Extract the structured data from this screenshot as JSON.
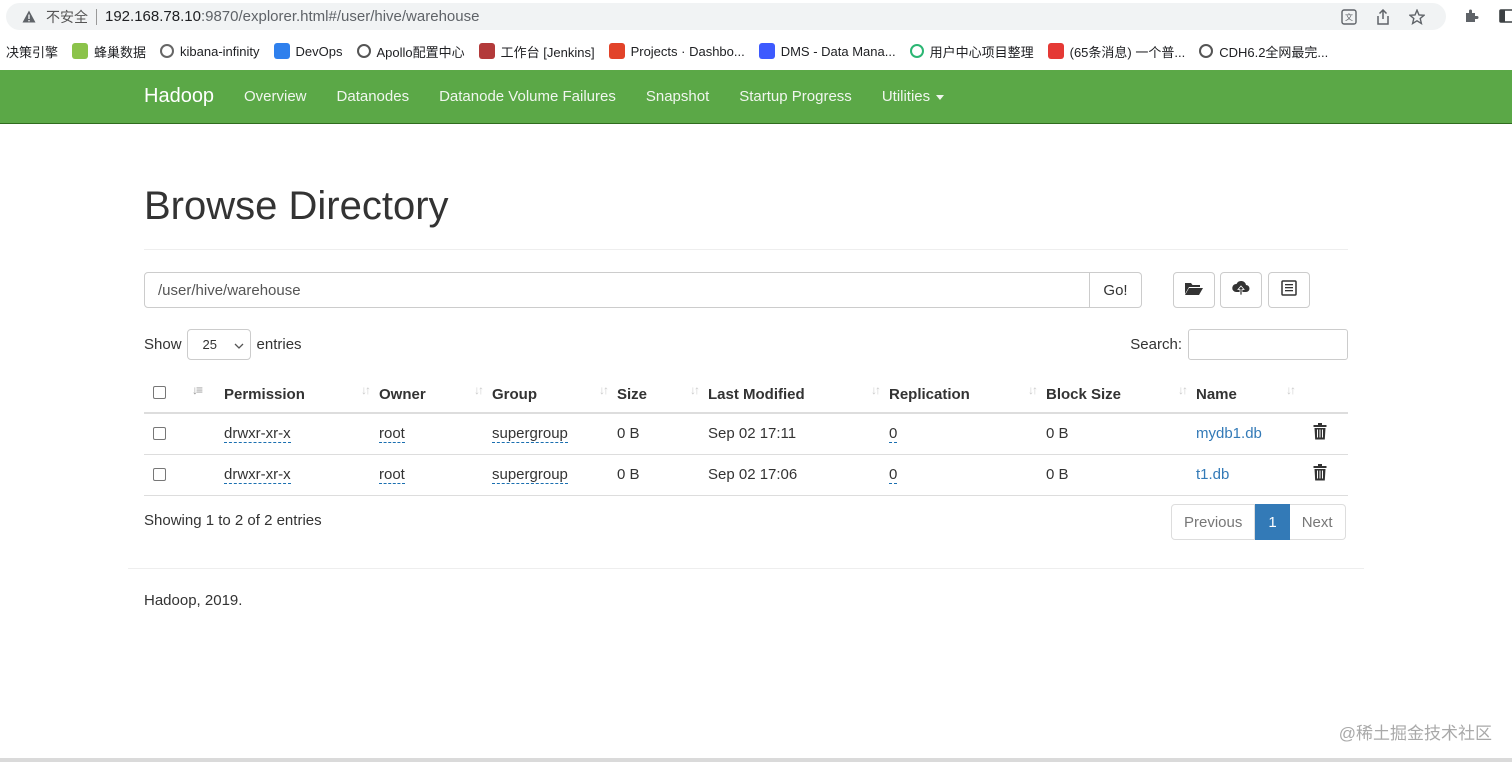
{
  "browser": {
    "security_label": "不安全",
    "url_host": "192.168.78.10",
    "url_path": ":9870/explorer.html#/user/hive/warehouse",
    "bookmarks": [
      {
        "label": "决策引擎",
        "icon": "none"
      },
      {
        "label": "蜂巢数据",
        "icon": "leaf-icon",
        "color": "#8bc34a"
      },
      {
        "label": "kibana-infinity",
        "icon": "kibana-icon",
        "color": "#666666"
      },
      {
        "label": "DevOps",
        "icon": "devops-icon",
        "color": "#2f80ed"
      },
      {
        "label": "Apollo配置中心",
        "icon": "apollo-icon",
        "color": "#555555"
      },
      {
        "label": "工作台 [Jenkins]",
        "icon": "jenkins-icon",
        "color": "#b33a3a"
      },
      {
        "label": "Projects · Dashbo...",
        "icon": "gitlab-icon",
        "color": "#e24329"
      },
      {
        "label": "DMS - Data Mana...",
        "icon": "dms-icon",
        "color": "#3d5afe"
      },
      {
        "label": "用户中心项目整理",
        "icon": "refresh-icon",
        "color": "#2bb673"
      },
      {
        "label": "(65条消息) 一个普...",
        "icon": "csdn-icon",
        "color": "#e53935"
      },
      {
        "label": "CDH6.2全网最完...",
        "icon": "book-icon",
        "color": "#555555"
      }
    ]
  },
  "navbar": {
    "brand": "Hadoop",
    "items": [
      "Overview",
      "Datanodes",
      "Datanode Volume Failures",
      "Snapshot",
      "Startup Progress",
      "Utilities"
    ]
  },
  "main": {
    "title": "Browse Directory",
    "path_value": "/user/hive/warehouse",
    "go_label": "Go!",
    "show_label": "Show",
    "page_length": "25",
    "entries_label": "entries",
    "search_label": "Search:",
    "columns": [
      "Permission",
      "Owner",
      "Group",
      "Size",
      "Last Modified",
      "Replication",
      "Block Size",
      "Name"
    ],
    "rows": [
      {
        "permission": "drwxr-xr-x",
        "owner": "root",
        "group": "supergroup",
        "size": "0 B",
        "modified": "Sep 02 17:11",
        "replication": "0",
        "block_size": "0 B",
        "name": "mydb1.db"
      },
      {
        "permission": "drwxr-xr-x",
        "owner": "root",
        "group": "supergroup",
        "size": "0 B",
        "modified": "Sep 02 17:06",
        "replication": "0",
        "block_size": "0 B",
        "name": "t1.db"
      }
    ],
    "info": "Showing 1 to 2 of 2 entries",
    "pager": {
      "previous": "Previous",
      "current": "1",
      "next": "Next"
    }
  },
  "footer": "Hadoop, 2019.",
  "watermark": "@稀土掘金技术社区",
  "colors": {
    "navbar": "#5ba847",
    "link": "#337ab7",
    "active_page": "#337ab7"
  }
}
